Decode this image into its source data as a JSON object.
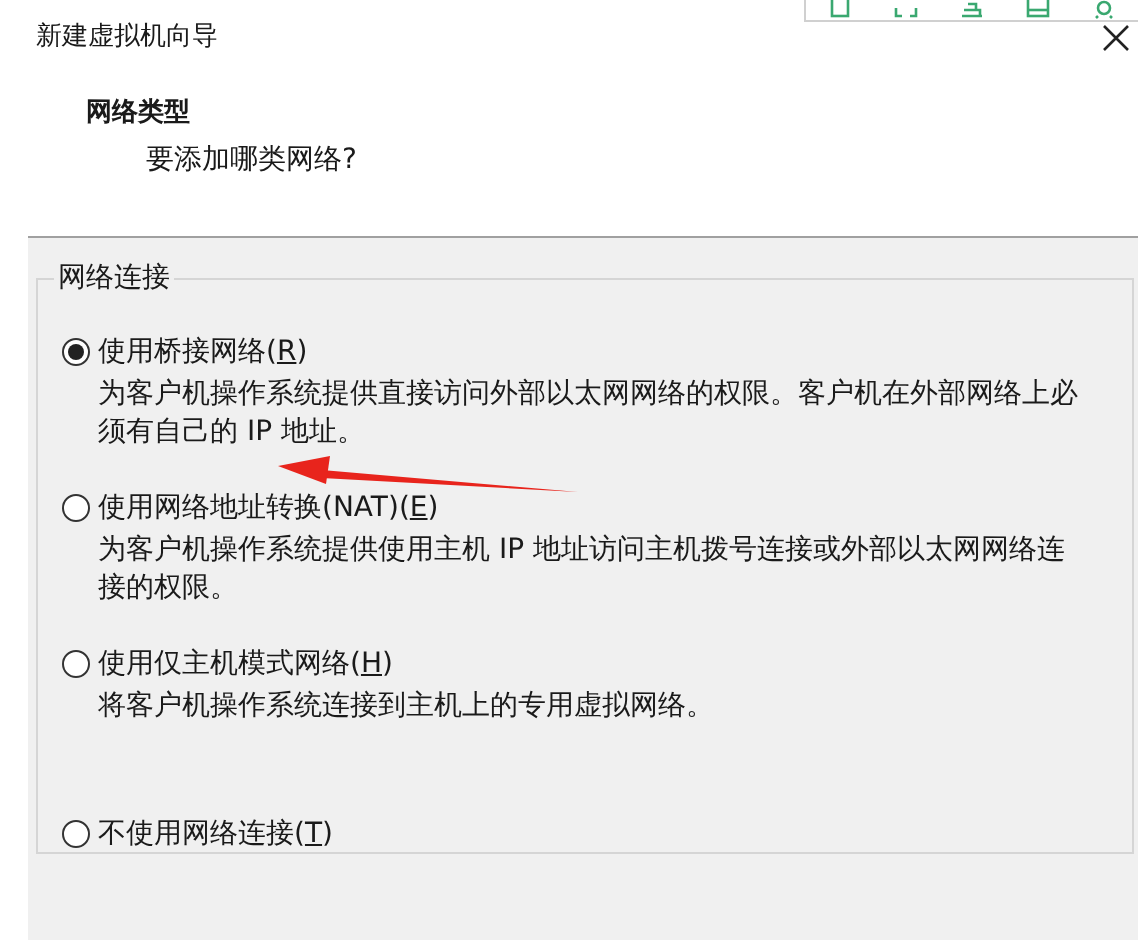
{
  "window": {
    "title": "新建虚拟机向导"
  },
  "header": {
    "title": "网络类型",
    "subtitle": "要添加哪类网络?"
  },
  "group": {
    "title": "网络连接",
    "options": [
      {
        "label": "使用桥接网络(",
        "access_key": "R",
        "label_tail": ")",
        "description": "为客户机操作系统提供直接访问外部以太网网络的权限。客户机在外部网络上必须有自己的 IP 地址。",
        "selected": true
      },
      {
        "label": "使用网络地址转换(NAT)(",
        "access_key": "E",
        "label_tail": ")",
        "description": "为客户机操作系统提供使用主机 IP 地址访问主机拨号连接或外部以太网网络连接的权限。",
        "selected": false
      },
      {
        "label": "使用仅主机模式网络(",
        "access_key": "H",
        "label_tail": ")",
        "description": "将客户机操作系统连接到主机上的专用虚拟网络。",
        "selected": false
      },
      {
        "label": "不使用网络连接(",
        "access_key": "T",
        "label_tail": ")",
        "selected": false
      }
    ]
  }
}
